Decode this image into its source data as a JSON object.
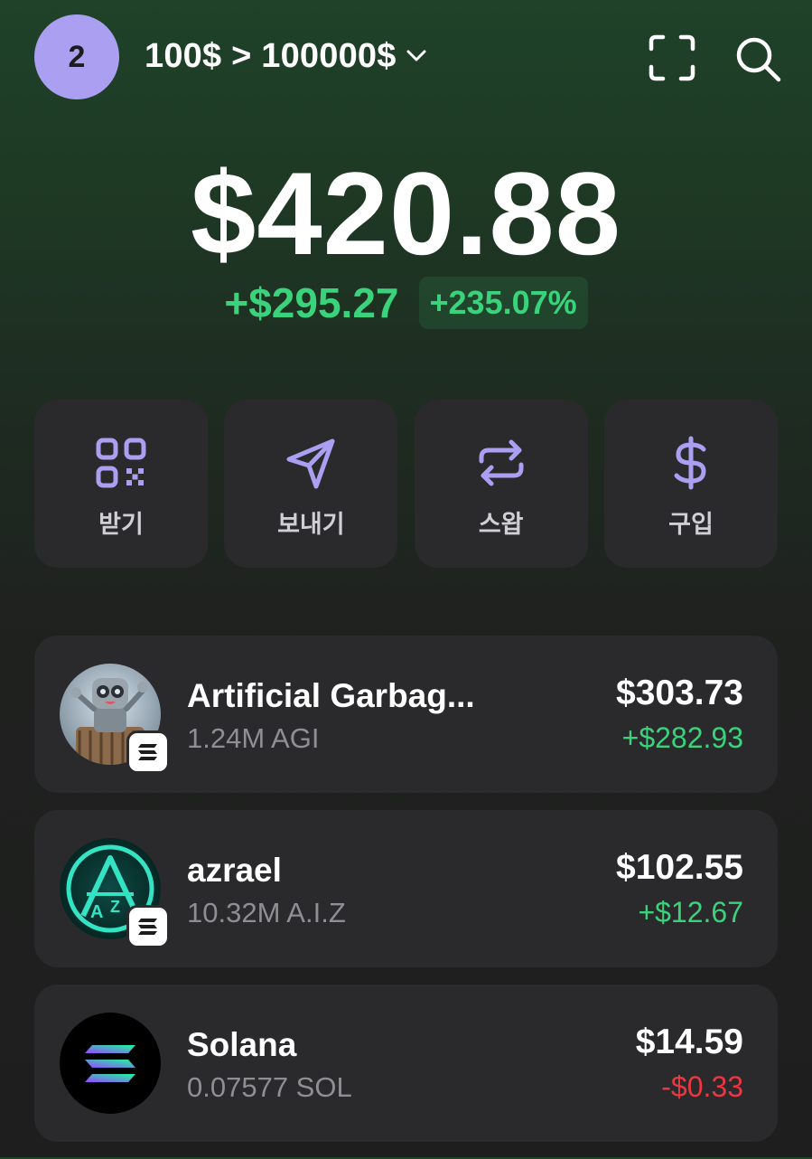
{
  "header": {
    "avatar_label": "2",
    "account_name": "100$ > 100000$",
    "icons": [
      "chevron-down-icon",
      "scan-icon",
      "search-icon"
    ]
  },
  "portfolio": {
    "balance": "$420.88",
    "change_abs": "+$295.27",
    "change_pct": "+235.07%"
  },
  "actions": [
    {
      "label": "받기",
      "icon": "qr-code-icon"
    },
    {
      "label": "보내기",
      "icon": "send-icon"
    },
    {
      "label": "스왑",
      "icon": "swap-icon"
    },
    {
      "label": "구입",
      "icon": "dollar-icon"
    }
  ],
  "tokens": [
    {
      "name": "Artificial Garbag...",
      "amount": "1.24M AGI",
      "value": "$303.73",
      "change": "+$282.93",
      "direction": "up"
    },
    {
      "name": "azrael",
      "amount": "10.32M A.I.Z",
      "value": "$102.55",
      "change": "+$12.67",
      "direction": "up"
    },
    {
      "name": "Solana",
      "amount": "0.07577 SOL",
      "value": "$14.59",
      "change": "-$0.33",
      "direction": "down"
    }
  ],
  "colors": {
    "accent": "#ab9ff2",
    "positive": "#3ad27a",
    "negative": "#eb3742",
    "card": "#2a2a2c"
  }
}
